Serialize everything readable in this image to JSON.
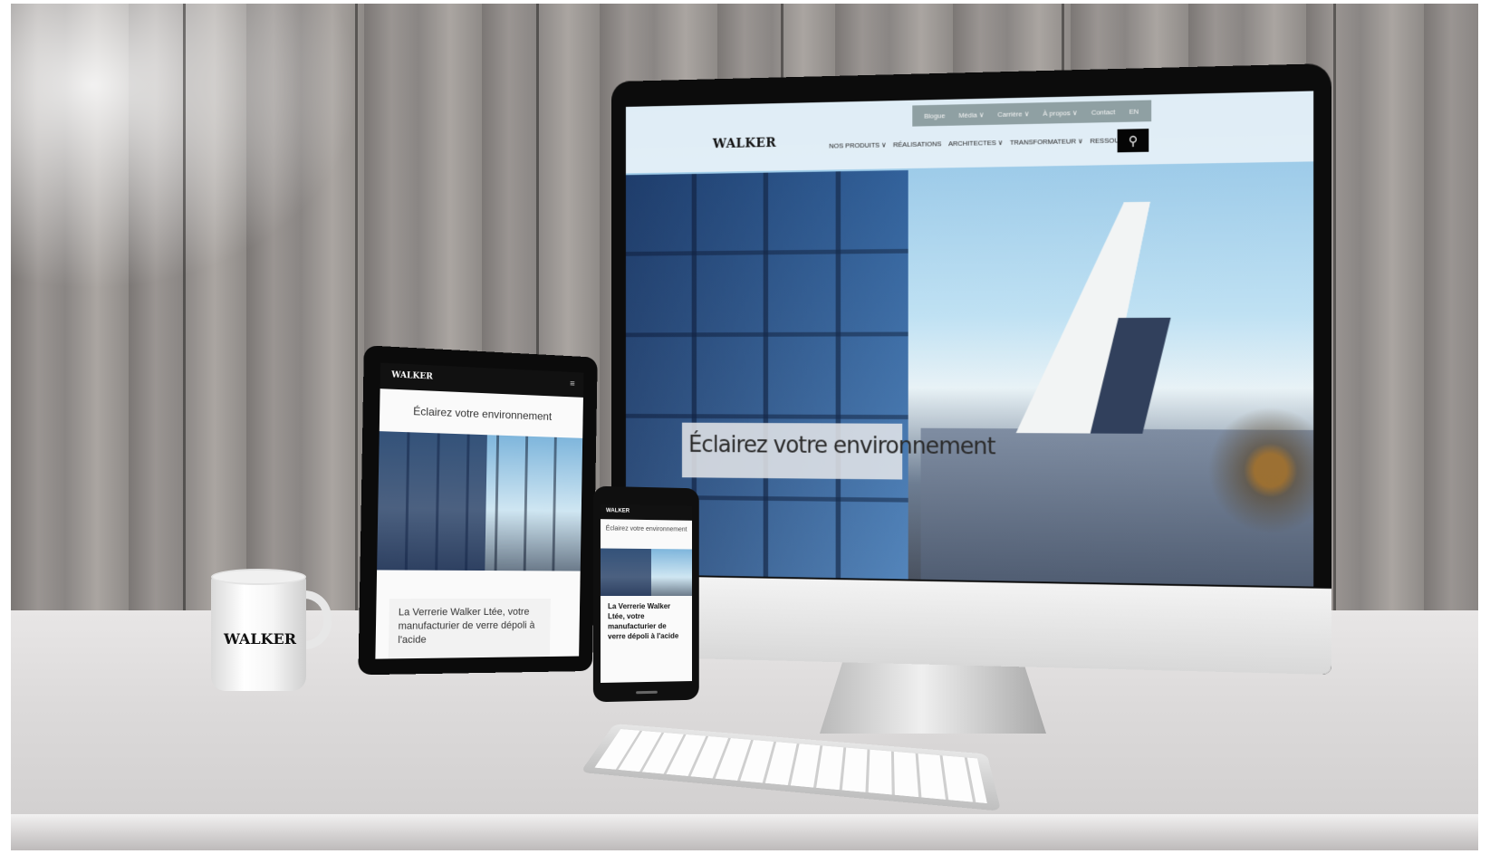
{
  "monitor": {
    "logo": "WALKER",
    "top_links": [
      "Blogue",
      "Média ∨",
      "Carrière ∨",
      "À propos ∨",
      "Contact",
      "EN"
    ],
    "main_nav": [
      "NOS PRODUITS ∨",
      "RÉALISATIONS",
      "ARCHITECTES ∨",
      "TRANSFORMATEUR ∨",
      "RESSOURCES ∨"
    ],
    "search_glyph": "⚲",
    "hero_text": "Éclairez votre environnement"
  },
  "tablet": {
    "logo": "WALKER",
    "menu_glyph": "≡",
    "title": "Éclairez votre environnement",
    "card_text": "La Verrerie Walker Ltée, votre manufacturier de verre dépoli à l'acide"
  },
  "phone": {
    "logo": "WALKER",
    "title": "Éclairez votre environnement",
    "card_text": "La Verrerie Walker Ltée, votre manufacturier de verre dépoli à l'acide"
  },
  "mug": {
    "logo": "WALKER"
  },
  "colors": {
    "header_bg": "#ebf2f8",
    "topbar_bg": "#8fa0a3",
    "search_bg": "#050505"
  }
}
